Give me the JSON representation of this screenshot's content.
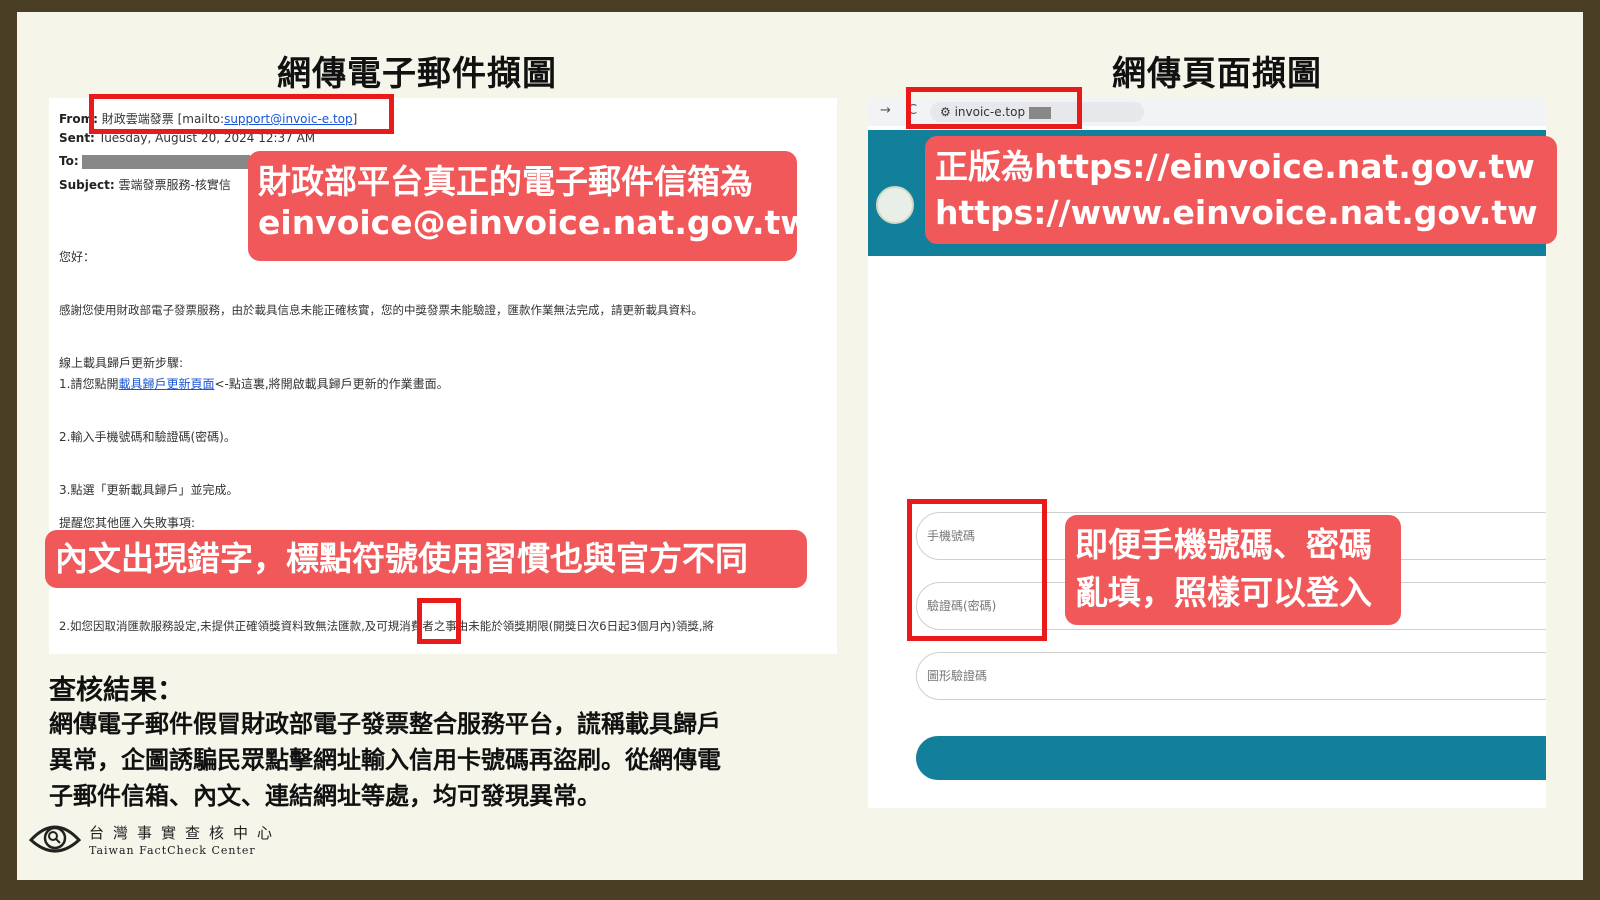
{
  "headings": {
    "left": "網傳電子郵件擷圖",
    "right": "網傳頁面擷圖"
  },
  "email": {
    "from_label": "From:",
    "from_name": "財政雲端發票",
    "from_addr_prefix": "[mailto:",
    "from_addr": "support@invoic-e.top",
    "from_addr_suffix": "]",
    "sent_label": "Sent:",
    "sent_value": "Tuesday, August 20, 2024 12:37 AM",
    "to_label": "To:",
    "subject_label": "Subject:",
    "subject_value": "雲端發票服務-核實信",
    "greeting": "您好：",
    "para1": "感謝您使用財政部電子發票服務，由於載具信息未能正確核實，您的中獎發票未能驗證，匯款作業無法完成，請更新載具資料。",
    "steps_title": "線上載具歸戶更新步驟:",
    "step1_prefix": "1.請您點開",
    "step1_link": "載具歸戶更新頁面",
    "step1_suffix": "<-點這裏,將開啟載具歸戶更新的作業畫面。",
    "step2": "2.輸入手機號碼和驗證碼(密碼)。",
    "step3": "3.點選「更新載具歸戶」並完成。",
    "reminder": "提醒您其他匯入失敗事項:",
    "item2": "2.如您因取消匯款服務設定,未提供正確領獎資料致無法匯款,及可規消費者之事由未能於領獎期限(開獎日次6日起3個月內)領獎,將"
  },
  "callouts": {
    "email_addr_line1": "財政部平台真正的電子郵件信箱為",
    "email_addr_line2": "einvoice@einvoice.nat.gov.tw",
    "typo": "內文出現錯字，標點符號使用習慣也與官方不同",
    "official_url_line1": "正版為https://einvoice.nat.gov.tw",
    "official_url_line2": "https://www.einvoice.nat.gov.tw",
    "login_line1": "即便手機號碼、密碼",
    "login_line2": "亂填，照樣可以登入"
  },
  "result": {
    "title": "查核結果：",
    "line1": "網傳電子郵件假冒財政部電子發票整合服務平台，謊稱載具歸戶",
    "line2": "異常，企圖誘騙民眾點擊網址輸入信用卡號碼再盜刷。從網傳電",
    "line3": "子郵件信箱、內文、連結網址等處，均可發現異常。"
  },
  "browser": {
    "back_icon": "→",
    "reload_icon": "C",
    "url": "invoic-e.top",
    "phone_placeholder": "手機號碼",
    "code_placeholder": "驗證碼(密碼)",
    "captcha_placeholder": "圖形驗證碼"
  },
  "logo": {
    "name_cn": "台灣事實查核中心",
    "name_en": "Taiwan FactCheck Center"
  },
  "colors": {
    "frame": "#4a3f25",
    "background": "#f5f5ea",
    "callout": "#f0585a",
    "highlight_box": "#e81a1a",
    "site_teal": "#127f9b",
    "link": "#1a55d6"
  }
}
